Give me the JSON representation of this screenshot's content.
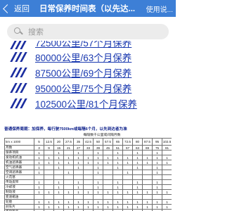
{
  "header": {
    "back_label": "返回",
    "title": "日常保养时间表（以先达...",
    "hint": "使用说..."
  },
  "search": {
    "placeholder": "搜索"
  },
  "links": [
    "72500公里/57个月保养",
    "80000公里/63个月保养",
    "87500公里/69个月保养",
    "95000公里/75个月保养",
    "102500公里/81个月保养"
  ],
  "table": {
    "header": "普通保养周期：加保养，每行驶7500km或每隔6个月，以先到达者为准",
    "subheader": "每隔数千公里或间隔月数",
    "km_row": [
      "5",
      "12.5",
      "20",
      "27.5",
      "35",
      "42.5",
      "50",
      "57.5",
      "65",
      "72.5",
      "80",
      "87.5",
      "95",
      "102.5"
    ],
    "month_row": [
      "3",
      "9",
      "15",
      "21",
      "27",
      "33",
      "39",
      "45",
      "51",
      "57",
      "63",
      "69",
      "75",
      "81"
    ],
    "rows": [
      {
        "label": "保养项目",
        "cells": [
          "1",
          "",
          "1",
          "",
          "1",
          "",
          "1",
          "",
          "1",
          "",
          "1",
          "",
          "1",
          ""
        ]
      },
      {
        "label": "发动机机油",
        "cells": [
          "1",
          "1",
          "1",
          "1",
          "1",
          "1",
          "1",
          "1",
          "1",
          "1",
          "1",
          "1",
          "1",
          "1"
        ]
      },
      {
        "label": "机油滤清器",
        "cells": [
          "1",
          "1",
          "1",
          "1",
          "1",
          "1",
          "1",
          "1",
          "1",
          "1",
          "1",
          "1",
          "1",
          "1"
        ]
      },
      {
        "label": "空气滤清器",
        "cells": [
          "1",
          "",
          "1",
          "",
          "1",
          "",
          "1",
          "",
          "1",
          "",
          "1",
          "",
          "1",
          ""
        ]
      },
      {
        "label": "空调滤清器",
        "cells": [
          "1",
          "",
          "",
          "1",
          "",
          "",
          "1",
          "",
          "",
          "1",
          "",
          "",
          "1",
          ""
        ]
      },
      {
        "label": "火花塞",
        "cells": [
          "",
          "",
          "",
          "",
          "",
          "",
          "",
          "",
          "",
          "",
          "",
          "",
          "",
          ""
        ]
      },
      {
        "label": "传动皮带",
        "cells": [
          "1",
          "",
          "1",
          "",
          "1",
          "",
          "1",
          "",
          "1",
          "",
          "1",
          "",
          "1",
          ""
        ]
      },
      {
        "label": "冷却液",
        "cells": [
          "1",
          "",
          "1",
          "",
          "1",
          "",
          "1",
          "",
          "1",
          "",
          "1",
          "",
          "1",
          ""
        ]
      },
      {
        "label": "制动液",
        "cells": [
          "1",
          "1",
          "1",
          "1",
          "1",
          "1",
          "1",
          "1",
          "1",
          "1",
          "1",
          "1",
          "1",
          "1"
        ]
      },
      {
        "label": "变速箱油",
        "cells": [
          "",
          "",
          "",
          "",
          "",
          "",
          "",
          "",
          "",
          "",
          "",
          "",
          "",
          ""
        ]
      },
      {
        "label": "轮胎",
        "cells": [
          "1",
          "1",
          "1",
          "1",
          "1",
          "1",
          "1",
          "1",
          "1",
          "1",
          "1",
          "1",
          "1",
          "1"
        ]
      },
      {
        "label": "刹车片",
        "cells": [
          "1",
          "1",
          "1",
          "1",
          "1",
          "1",
          "1",
          "1",
          "1",
          "1",
          "1",
          "1",
          "1",
          "1"
        ]
      },
      {
        "label": "底盘检查",
        "cells": [
          "1",
          "",
          "",
          "1",
          "",
          "",
          "1",
          "",
          "",
          "1",
          "",
          "",
          "1",
          ""
        ]
      }
    ]
  }
}
